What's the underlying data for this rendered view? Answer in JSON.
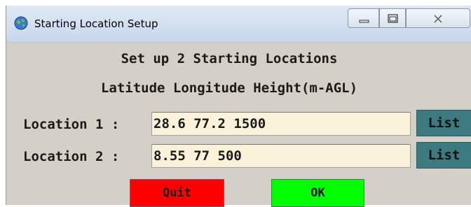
{
  "window": {
    "title": "Starting Location Setup"
  },
  "heading": {
    "line1": "Set up 2 Starting Locations",
    "line2": "Latitude Longitude Height(m-AGL)"
  },
  "locations": [
    {
      "label": "Location 1 :",
      "value": "28.6 77.2 1500",
      "list_label": "List"
    },
    {
      "label": "Location 2 :",
      "value": "8.55 77 500",
      "list_label": "List"
    }
  ],
  "actions": {
    "quit_label": "Quit",
    "ok_label": "OK"
  },
  "colors": {
    "quit": "#ff0000",
    "ok": "#00ff00",
    "list": "#3d7a80",
    "input_bg": "#fbf3d9",
    "window_bg": "#d4d0c8"
  }
}
